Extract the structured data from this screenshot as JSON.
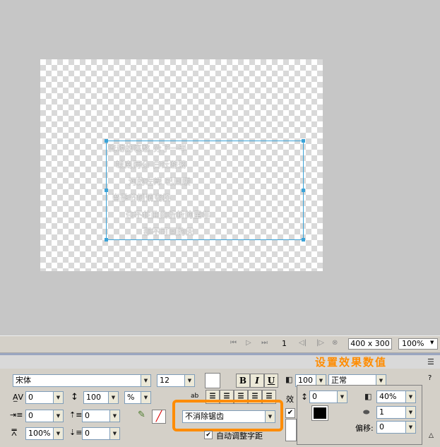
{
  "canvas": {
    "poem_lines": [
      "流动的哀愁 分了一半",
      "城南两朵 白云游荡",
      "河的左岸 已回暖",
      "当季节悄悄变换",
      "住不住曲曲折折的童年",
      "那不可回的天"
    ]
  },
  "status": {
    "frame": "1",
    "size": "400 x 300",
    "zoom": "100%"
  },
  "panel": {
    "hint": "设置效果数值",
    "font_name": "宋体",
    "font_size": "12",
    "bold": "B",
    "italic": "I",
    "underline": "U",
    "char_spacing": "0",
    "line_height": "100",
    "line_height_unit": "%",
    "indent": "0",
    "para_before": "0",
    "para_after": "0",
    "horiz_scale": "100%",
    "baseline": "0",
    "antialias": "不消除锯齿",
    "auto_kern": "自动调整字距",
    "opacity": "100",
    "blend": "正常",
    "effect_label": "效",
    "effect_checkbox": "✔",
    "fx_distance": "0",
    "fx_opacity": "40%",
    "fx_softness": "1",
    "fx_offset_label": "偏移:",
    "fx_offset": "0",
    "help": "?"
  }
}
